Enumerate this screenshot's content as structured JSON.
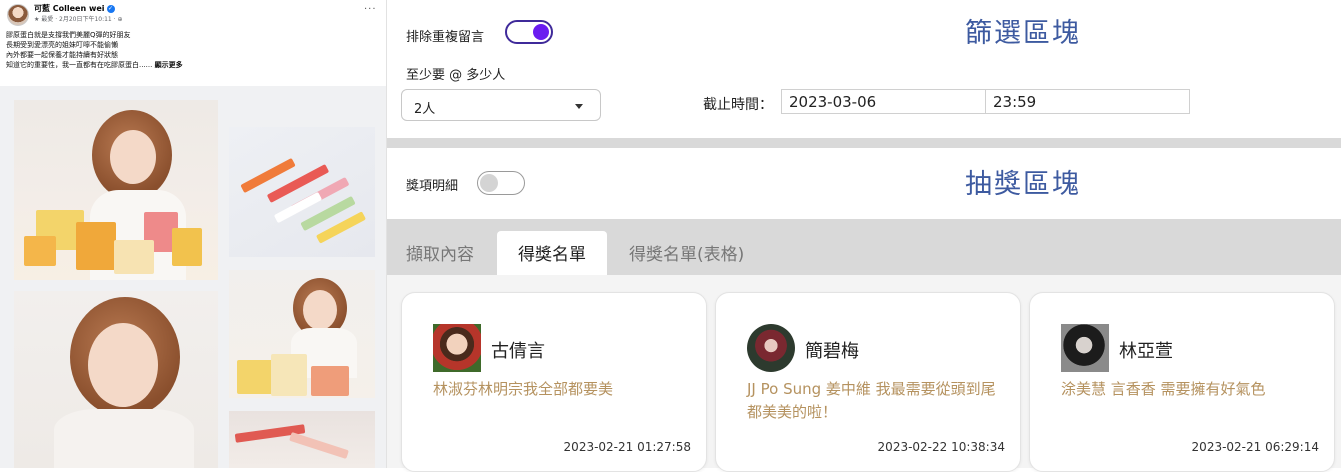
{
  "post": {
    "author": "可藍 Colleen wei",
    "verified_badge": "✓",
    "meta": "★ 最愛 · 2月20日下午10:11 · ⊕",
    "more_icon": "···",
    "lines": [
      "膠原蛋白就是支撐我們美麗Q彈的好朋友",
      "長期受到愛漂亮的姐妹叮嚀不能偷懶",
      "內外都要一起保養才能持續有好狀態",
      "知道它的重要性，我一直都有在吃膠原蛋白......"
    ],
    "see_more": "顯示更多"
  },
  "filter": {
    "title": "篩選區塊",
    "dedupe_label": "排除重複留言",
    "dedupe_on": true,
    "mention_label": "至少要 @ 多少人",
    "mention_value": "2人",
    "deadline_label": "截止時間：",
    "deadline_date": "2023-03-06",
    "deadline_time": "23:59"
  },
  "draw": {
    "title": "抽獎區塊",
    "prize_detail_label": "獎項明細",
    "prize_detail_on": false
  },
  "tabs": [
    {
      "label": "擷取內容",
      "active": false
    },
    {
      "label": "得獎名單",
      "active": true
    },
    {
      "label": "得獎名單(表格)",
      "active": false
    }
  ],
  "winners": [
    {
      "name": "古倩言",
      "message": "林淑芬林明宗我全部都要美",
      "time": "2023-02-21 01:27:58"
    },
    {
      "name": "簡碧梅",
      "message": "JJ Po Sung 姜中維 我最需要從頭到尾都美美的啦！",
      "time": "2023-02-22 10:38:34"
    },
    {
      "name": "林亞萱",
      "message": "涂美慧 言香香 需要擁有好氣色",
      "time": "2023-02-21 06:29:14"
    }
  ],
  "colors": {
    "section_title": "#3d5aa0",
    "toggle_on": "#6a1cf0",
    "message_text": "#b5925f",
    "divider": "#d9d9d9"
  }
}
